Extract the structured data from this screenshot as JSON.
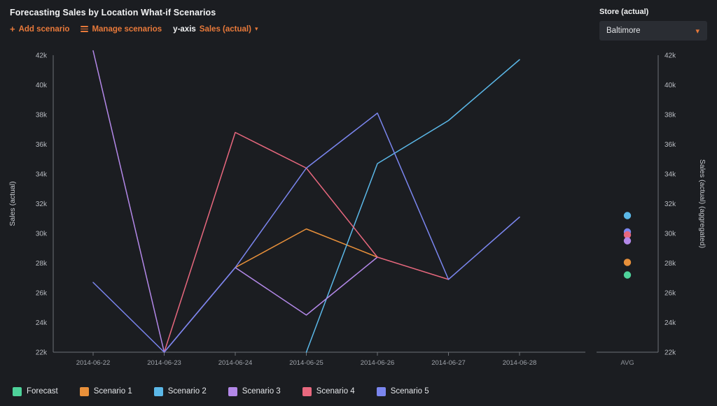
{
  "header": {
    "title": "Forecasting Sales by Location What-if Scenarios",
    "add_scenario_label": "Add scenario",
    "add_scenario_icon": "plus-icon",
    "manage_scenarios_label": "Manage scenarios",
    "manage_scenarios_icon": "sliders-icon",
    "yaxis_prefix": "y-axis",
    "yaxis_value": "Sales (actual)",
    "yaxis_caret_icon": "chevron-down-icon"
  },
  "store": {
    "label": "Store (actual)",
    "value": "Baltimore",
    "caret_icon": "chevron-down-icon"
  },
  "colors": {
    "background": "#1b1d21",
    "accent": "#e8793a",
    "forecast": "#4ed29a",
    "scenario1": "#e8903a",
    "scenario2": "#5bb8e8",
    "scenario3": "#b388e8",
    "scenario4": "#e8687e",
    "scenario5": "#7b86ef",
    "axis": "#6e7177"
  },
  "chart_data": {
    "type": "line",
    "title": "Forecasting Sales by Location What-if Scenarios",
    "xlabel": "",
    "ylabel": "Sales (actual)",
    "ylabel_right": "Sales (actual) (aggregated)",
    "grid": false,
    "legend_position": "bottom",
    "ylim": [
      22000,
      42000
    ],
    "ytick_labels": [
      "42k",
      "40k",
      "38k",
      "36k",
      "34k",
      "32k",
      "30k",
      "28k",
      "26k",
      "24k",
      "22k"
    ],
    "ytick_values": [
      42000,
      40000,
      38000,
      36000,
      34000,
      32000,
      30000,
      28000,
      26000,
      24000,
      22000
    ],
    "categories": [
      "2014-06-22",
      "2014-06-23",
      "2014-06-24",
      "2014-06-25",
      "2014-06-26",
      "2014-06-27",
      "2014-06-28"
    ],
    "series": [
      {
        "name": "Forecast",
        "color": "#4ed29a",
        "values": [
          null,
          null,
          null,
          null,
          null,
          null,
          null
        ]
      },
      {
        "name": "Scenario 1",
        "color": "#e8903a",
        "values": [
          null,
          null,
          27700,
          30300,
          28400,
          null,
          null
        ]
      },
      {
        "name": "Scenario 2",
        "color": "#5bb8e8",
        "values": [
          null,
          null,
          null,
          22000,
          34700,
          37600,
          41700
        ]
      },
      {
        "name": "Scenario 3",
        "color": "#b388e8",
        "values": [
          42300,
          22000,
          27700,
          24500,
          28400,
          null,
          null
        ]
      },
      {
        "name": "Scenario 4",
        "color": "#e8687e",
        "values": [
          null,
          22000,
          36800,
          34400,
          28400,
          26900,
          null
        ]
      },
      {
        "name": "Scenario 5",
        "color": "#7b86ef",
        "values": [
          26700,
          22000,
          27700,
          34400,
          38100,
          26900,
          31100
        ]
      }
    ],
    "aggregate": {
      "label": "AVG",
      "axis_label": "Sales (actual) (aggregated)",
      "points": [
        {
          "name": "Scenario 2",
          "color": "#5bb8e8",
          "value": 31200
        },
        {
          "name": "Scenario 5",
          "color": "#7b86ef",
          "value": 30100
        },
        {
          "name": "Scenario 4",
          "color": "#e8687e",
          "value": 29900
        },
        {
          "name": "Scenario 3",
          "color": "#b388e8",
          "value": 29500
        },
        {
          "name": "Scenario 1",
          "color": "#e8903a",
          "value": 28050
        },
        {
          "name": "Forecast",
          "color": "#4ed29a",
          "value": 27200
        }
      ]
    }
  },
  "legend": {
    "items": [
      {
        "label": "Forecast",
        "color": "#4ed29a"
      },
      {
        "label": "Scenario 1",
        "color": "#e8903a"
      },
      {
        "label": "Scenario 2",
        "color": "#5bb8e8"
      },
      {
        "label": "Scenario 3",
        "color": "#b388e8"
      },
      {
        "label": "Scenario 4",
        "color": "#e8687e"
      },
      {
        "label": "Scenario 5",
        "color": "#7b86ef"
      }
    ]
  }
}
